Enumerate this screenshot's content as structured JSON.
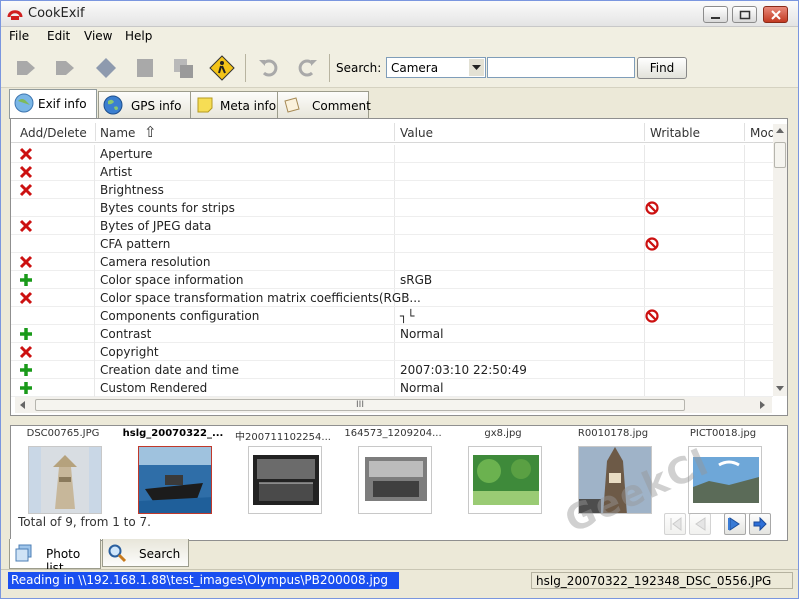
{
  "window": {
    "title": "CookExif"
  },
  "menu": [
    "File",
    "Edit",
    "View",
    "Help"
  ],
  "toolbar": {
    "search_label": "Search:",
    "search_field_value": "Camera",
    "search_input_value": "",
    "find_label": "Find",
    "icons": [
      "back-arrow-icon",
      "forward-arrow-icon",
      "tag-icon",
      "page-icon",
      "copy-icon",
      "warning-sign-icon",
      "undo-icon",
      "redo-icon"
    ]
  },
  "tabs": [
    {
      "label": "Exif info",
      "icon": "globe-icon",
      "active": true
    },
    {
      "label": "GPS info",
      "icon": "earth-icon",
      "active": false
    },
    {
      "label": "Meta info",
      "icon": "note-icon",
      "active": false
    },
    {
      "label": "Comment",
      "icon": "paper-icon",
      "active": false
    }
  ],
  "grid": {
    "columns": [
      "Add/Delete",
      "Name",
      "Value",
      "Writable",
      "Mod"
    ],
    "sort_indicator": "⇧",
    "rows": [
      {
        "action": "delete",
        "name": "Aperture",
        "value": "",
        "writable": ""
      },
      {
        "action": "delete",
        "name": "Artist",
        "value": "",
        "writable": ""
      },
      {
        "action": "delete",
        "name": "Brightness",
        "value": "",
        "writable": ""
      },
      {
        "action": "",
        "name": "Bytes counts for strips",
        "value": "",
        "writable": "no"
      },
      {
        "action": "delete",
        "name": "Bytes of JPEG data",
        "value": "",
        "writable": ""
      },
      {
        "action": "",
        "name": "CFA pattern",
        "value": "",
        "writable": "no"
      },
      {
        "action": "delete",
        "name": "Camera resolution",
        "value": "",
        "writable": ""
      },
      {
        "action": "add",
        "name": "Color space information",
        "value": "sRGB",
        "writable": ""
      },
      {
        "action": "delete",
        "name": "Color space transformation matrix coefficients(RGB...",
        "value": "",
        "writable": ""
      },
      {
        "action": "",
        "name": "Components configuration",
        "value": "┐└",
        "writable": "no"
      },
      {
        "action": "add",
        "name": "Contrast",
        "value": "Normal",
        "writable": ""
      },
      {
        "action": "delete",
        "name": "Copyright",
        "value": "",
        "writable": ""
      },
      {
        "action": "add",
        "name": "Creation date and time",
        "value": "2007:03:10 22:50:49",
        "writable": ""
      },
      {
        "action": "add",
        "name": "Custom Rendered",
        "value": "Normal",
        "writable": ""
      }
    ],
    "hscroll_grip": "III"
  },
  "thumbnails": {
    "items": [
      {
        "caption": "DSC00765.JPG",
        "selected": false,
        "scene": "pagoda"
      },
      {
        "caption": "hslg_20070322_...",
        "selected": true,
        "scene": "boat"
      },
      {
        "caption": "中200711102254...",
        "selected": false,
        "scene": "building"
      },
      {
        "caption": "164573_1209204...",
        "selected": false,
        "scene": "interior"
      },
      {
        "caption": "gx8.jpg",
        "selected": false,
        "scene": "garden"
      },
      {
        "caption": "R0010178.jpg",
        "selected": false,
        "scene": "tower"
      },
      {
        "caption": "PICT0018.jpg",
        "selected": false,
        "scene": "sky"
      }
    ],
    "total_text": "Total of 9, from 1 to 7."
  },
  "bottom_tabs": [
    {
      "label": "Photo list",
      "icon": "photos-icon",
      "active": true
    },
    {
      "label": "Search",
      "icon": "magnifier-icon",
      "active": false
    }
  ],
  "status": {
    "left": "Reading in \\\\192.168.1.88\\test_images\\Olympus\\PB200008.jpg",
    "right": "hslg_20070322_192348_DSC_0556.JPG"
  },
  "watermark": "GeekCl",
  "colors": {
    "delete": "#cc1111",
    "add": "#1a9a1a",
    "status_highlight": "#1a4ff0",
    "no_write": "#cc1111"
  }
}
